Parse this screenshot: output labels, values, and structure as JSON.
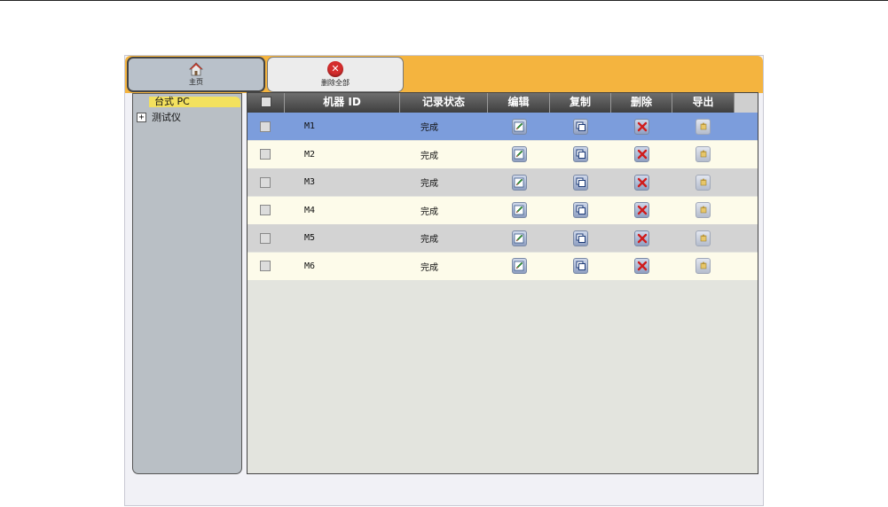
{
  "toolbar": {
    "home_label": "主页",
    "delete_all_label": "删除全部"
  },
  "sidebar": {
    "items": [
      {
        "label": "台式 PC",
        "selected": true
      },
      {
        "label": "测试仪",
        "expander": "+"
      }
    ]
  },
  "table": {
    "columns": [
      "机器 ID",
      "记录状态",
      "编辑",
      "复制",
      "删除",
      "导出"
    ],
    "rows": [
      {
        "id": "M1",
        "status": "完成",
        "selected": true
      },
      {
        "id": "M2",
        "status": "完成"
      },
      {
        "id": "M3",
        "status": "完成"
      },
      {
        "id": "M4",
        "status": "完成"
      },
      {
        "id": "M5",
        "status": "完成"
      },
      {
        "id": "M6",
        "status": "完成"
      }
    ]
  },
  "colors": {
    "toolbar": "#f4b43f",
    "selected_row": "#7c9ddc",
    "tree_highlight": "#f3e15e"
  },
  "icons": [
    "home-icon",
    "delete-all-icon",
    "edit-icon",
    "copy-icon",
    "delete-icon",
    "export-icon"
  ]
}
